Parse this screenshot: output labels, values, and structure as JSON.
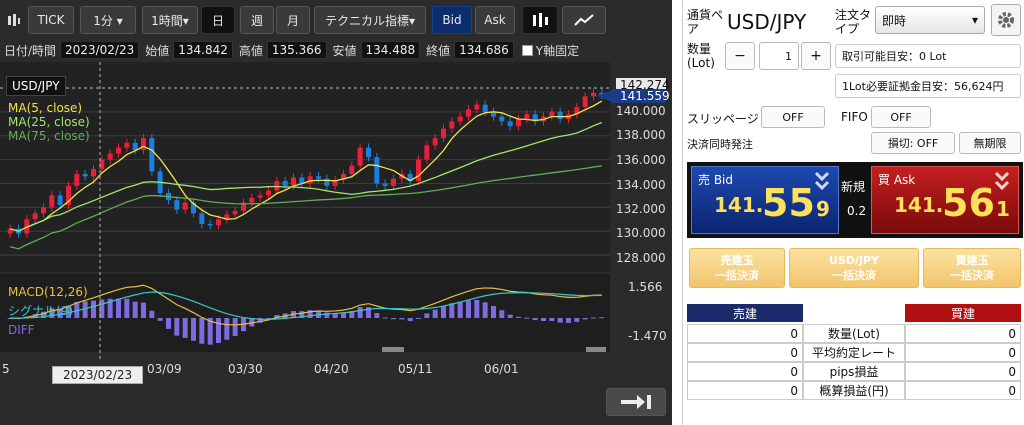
{
  "toolbar": {
    "tick": "TICK",
    "interval": "1分 ▾",
    "period": "1時間▾",
    "day": "日",
    "week": "週",
    "month": "月",
    "technical": "テクニカル指標▾",
    "bid": "Bid",
    "ask": "Ask"
  },
  "ohlc": {
    "date_label": "日付/時間",
    "date": "2023/02/23",
    "open_label": "始値",
    "open": "134.842",
    "high_label": "高値",
    "high": "135.366",
    "low_label": "安値",
    "low": "134.488",
    "close_label": "終値",
    "close": "134.686",
    "yfix_label": "Y軸固定"
  },
  "chart": {
    "symbol": "USD/JPY",
    "ma5": "MA(5, close)",
    "ma25": "MA(25, close)",
    "ma75": "MA(75, close)",
    "price_marker": "142.274",
    "price_marker2": "141.559",
    "y_ticks": [
      "140.000",
      "138.000",
      "136.000",
      "134.000",
      "132.000",
      "130.000",
      "128.000"
    ],
    "macd_hi": "1.566",
    "macd_lo": "-1.470",
    "macd": "MACD(12,26)",
    "signal": "シグナル(9)",
    "diff": "DIFF",
    "x_ticks": [
      "5",
      "03/09",
      "03/30",
      "04/20",
      "05/11",
      "06/01"
    ],
    "cursor_date": "2023/02/23",
    "colors": {
      "up": "#e8203a",
      "down": "#1c7fe0",
      "ma5": "#f3e24a",
      "ma25": "#9ee86a",
      "ma75": "#5fae5a",
      "macd": "#e6c040",
      "signal": "#38c8c8",
      "diff": "#7d6ce0"
    }
  },
  "chart_data": {
    "type": "candlestick",
    "x_ticks": [
      "03/09",
      "03/30",
      "04/20",
      "05/11",
      "06/01"
    ],
    "ylim": [
      127,
      142.5
    ],
    "last_price": 141.559,
    "high_marker": 142.274,
    "closes": [
      130.2,
      129.8,
      131.0,
      131.5,
      132.0,
      133.0,
      132.2,
      133.8,
      134.8,
      134.6,
      135.2,
      136.0,
      136.5,
      137.0,
      137.4,
      136.8,
      137.8,
      135.0,
      133.2,
      132.6,
      131.8,
      132.4,
      131.5,
      130.6,
      130.5,
      131.0,
      131.4,
      131.7,
      132.4,
      132.8,
      133.0,
      133.4,
      134.2,
      133.8,
      134.5,
      134.0,
      134.6,
      134.4,
      133.8,
      134.3,
      134.8,
      135.5,
      137.0,
      136.2,
      134.0,
      133.8,
      134.4,
      134.8,
      134.2,
      136.0,
      137.2,
      137.8,
      138.6,
      139.2,
      139.6,
      140.2,
      140.6,
      140.0,
      139.6,
      139.2,
      138.8,
      139.4,
      139.8,
      139.2,
      139.6,
      140.0,
      139.4,
      139.8,
      140.4,
      141.3,
      141.6,
      141.4
    ],
    "macd": {
      "high": 1.566,
      "low": -1.47
    }
  },
  "order": {
    "pair_label": "通貨ペア",
    "pair": "USD/JPY",
    "order_type_label": "注文タイプ",
    "order_type": "即時",
    "qty_label": "数量(Lot)",
    "qty": "1",
    "minus": "−",
    "plus": "+",
    "tradable": "取引可能目安：0 Lot",
    "margin": "1Lot必要証拠金目安：56,624円",
    "slippage_label": "スリッページ",
    "slippage": "OFF",
    "fifo_label": "FIFO",
    "fifo": "OFF",
    "settle_label": "決済同時発注",
    "stoploss": "損切: OFF",
    "unlimited": "無期限",
    "sell_label": "売 Bid",
    "sell_pre": "141.",
    "sell_big": "55",
    "sell_small": "9",
    "new_label": "新規",
    "spread": "0.2",
    "buy_label": "買 Ask",
    "buy_pre": "141.",
    "buy_big": "56",
    "buy_small": "1",
    "close_sell": "売建玉\n一括決済",
    "close_pair": "USD/JPY\n一括決済",
    "close_buy": "買建玉\n一括決済",
    "sell_hdr": "売建",
    "buy_hdr": "買建",
    "rows": [
      {
        "label": "数量(Lot)",
        "sell": "0",
        "buy": "0"
      },
      {
        "label": "平均約定レート",
        "sell": "0",
        "buy": "0"
      },
      {
        "label": "pips損益",
        "sell": "0",
        "buy": "0"
      },
      {
        "label": "概算損益(円)",
        "sell": "0",
        "buy": "0"
      }
    ]
  }
}
